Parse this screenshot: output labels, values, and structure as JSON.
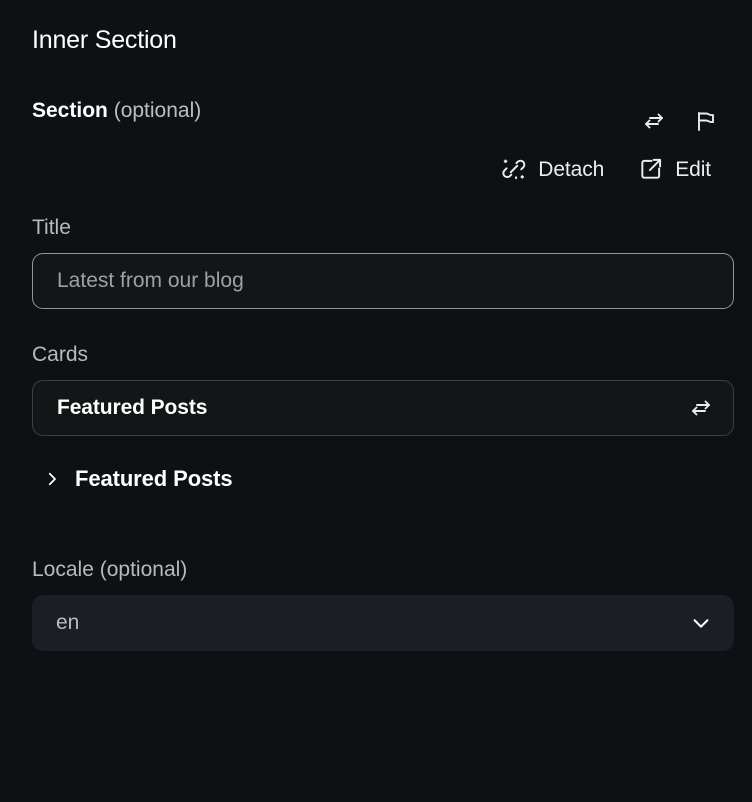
{
  "page": {
    "title": "Inner Section",
    "background_color": "#0d1113"
  },
  "section_header": {
    "label_strong": "Section",
    "label_optional": "(optional)",
    "actions": [
      {
        "name": "swap-icon",
        "icon": "swap-arrows"
      },
      {
        "name": "flag-icon",
        "icon": "flag"
      }
    ]
  },
  "sub_actions": [
    {
      "label": "Detach",
      "icon": "unlink-sparkle"
    },
    {
      "label": "Edit",
      "icon": "external-link"
    }
  ],
  "fields": {
    "title": {
      "label": "Title",
      "placeholder": "Latest from our blog",
      "value": ""
    },
    "cards": {
      "label": "Cards",
      "value": "Featured Posts",
      "swap_icon": "swap-arrows"
    },
    "locale": {
      "label_strong": "Locale",
      "label_optional": "(optional)",
      "value": "en",
      "chevron": "chevron-down",
      "options": [
        "en"
      ]
    }
  },
  "accordion": {
    "title": "Featured Posts",
    "expanded": false,
    "chevron": "chevron-right"
  },
  "colors": {
    "background": "#0d1113",
    "field_background": "#121617",
    "select_background": "#1b1f25",
    "border_active": "#8e9699",
    "border_muted": "#3a4145",
    "text_primary": "#ffffff",
    "text_muted": "#b4bcbe",
    "text_placeholder": "#9aa2a5"
  }
}
